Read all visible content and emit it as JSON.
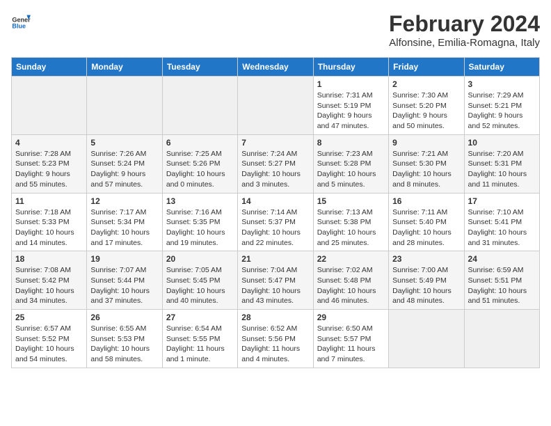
{
  "header": {
    "logo_general": "General",
    "logo_blue": "Blue",
    "title": "February 2024",
    "subtitle": "Alfonsine, Emilia-Romagna, Italy"
  },
  "days_of_week": [
    "Sunday",
    "Monday",
    "Tuesday",
    "Wednesday",
    "Thursday",
    "Friday",
    "Saturday"
  ],
  "weeks": [
    [
      {
        "day": "",
        "info": ""
      },
      {
        "day": "",
        "info": ""
      },
      {
        "day": "",
        "info": ""
      },
      {
        "day": "",
        "info": ""
      },
      {
        "day": "1",
        "info": "Sunrise: 7:31 AM\nSunset: 5:19 PM\nDaylight: 9 hours and 47 minutes."
      },
      {
        "day": "2",
        "info": "Sunrise: 7:30 AM\nSunset: 5:20 PM\nDaylight: 9 hours and 50 minutes."
      },
      {
        "day": "3",
        "info": "Sunrise: 7:29 AM\nSunset: 5:21 PM\nDaylight: 9 hours and 52 minutes."
      }
    ],
    [
      {
        "day": "4",
        "info": "Sunrise: 7:28 AM\nSunset: 5:23 PM\nDaylight: 9 hours and 55 minutes."
      },
      {
        "day": "5",
        "info": "Sunrise: 7:26 AM\nSunset: 5:24 PM\nDaylight: 9 hours and 57 minutes."
      },
      {
        "day": "6",
        "info": "Sunrise: 7:25 AM\nSunset: 5:26 PM\nDaylight: 10 hours and 0 minutes."
      },
      {
        "day": "7",
        "info": "Sunrise: 7:24 AM\nSunset: 5:27 PM\nDaylight: 10 hours and 3 minutes."
      },
      {
        "day": "8",
        "info": "Sunrise: 7:23 AM\nSunset: 5:28 PM\nDaylight: 10 hours and 5 minutes."
      },
      {
        "day": "9",
        "info": "Sunrise: 7:21 AM\nSunset: 5:30 PM\nDaylight: 10 hours and 8 minutes."
      },
      {
        "day": "10",
        "info": "Sunrise: 7:20 AM\nSunset: 5:31 PM\nDaylight: 10 hours and 11 minutes."
      }
    ],
    [
      {
        "day": "11",
        "info": "Sunrise: 7:18 AM\nSunset: 5:33 PM\nDaylight: 10 hours and 14 minutes."
      },
      {
        "day": "12",
        "info": "Sunrise: 7:17 AM\nSunset: 5:34 PM\nDaylight: 10 hours and 17 minutes."
      },
      {
        "day": "13",
        "info": "Sunrise: 7:16 AM\nSunset: 5:35 PM\nDaylight: 10 hours and 19 minutes."
      },
      {
        "day": "14",
        "info": "Sunrise: 7:14 AM\nSunset: 5:37 PM\nDaylight: 10 hours and 22 minutes."
      },
      {
        "day": "15",
        "info": "Sunrise: 7:13 AM\nSunset: 5:38 PM\nDaylight: 10 hours and 25 minutes."
      },
      {
        "day": "16",
        "info": "Sunrise: 7:11 AM\nSunset: 5:40 PM\nDaylight: 10 hours and 28 minutes."
      },
      {
        "day": "17",
        "info": "Sunrise: 7:10 AM\nSunset: 5:41 PM\nDaylight: 10 hours and 31 minutes."
      }
    ],
    [
      {
        "day": "18",
        "info": "Sunrise: 7:08 AM\nSunset: 5:42 PM\nDaylight: 10 hours and 34 minutes."
      },
      {
        "day": "19",
        "info": "Sunrise: 7:07 AM\nSunset: 5:44 PM\nDaylight: 10 hours and 37 minutes."
      },
      {
        "day": "20",
        "info": "Sunrise: 7:05 AM\nSunset: 5:45 PM\nDaylight: 10 hours and 40 minutes."
      },
      {
        "day": "21",
        "info": "Sunrise: 7:04 AM\nSunset: 5:47 PM\nDaylight: 10 hours and 43 minutes."
      },
      {
        "day": "22",
        "info": "Sunrise: 7:02 AM\nSunset: 5:48 PM\nDaylight: 10 hours and 46 minutes."
      },
      {
        "day": "23",
        "info": "Sunrise: 7:00 AM\nSunset: 5:49 PM\nDaylight: 10 hours and 48 minutes."
      },
      {
        "day": "24",
        "info": "Sunrise: 6:59 AM\nSunset: 5:51 PM\nDaylight: 10 hours and 51 minutes."
      }
    ],
    [
      {
        "day": "25",
        "info": "Sunrise: 6:57 AM\nSunset: 5:52 PM\nDaylight: 10 hours and 54 minutes."
      },
      {
        "day": "26",
        "info": "Sunrise: 6:55 AM\nSunset: 5:53 PM\nDaylight: 10 hours and 58 minutes."
      },
      {
        "day": "27",
        "info": "Sunrise: 6:54 AM\nSunset: 5:55 PM\nDaylight: 11 hours and 1 minute."
      },
      {
        "day": "28",
        "info": "Sunrise: 6:52 AM\nSunset: 5:56 PM\nDaylight: 11 hours and 4 minutes."
      },
      {
        "day": "29",
        "info": "Sunrise: 6:50 AM\nSunset: 5:57 PM\nDaylight: 11 hours and 7 minutes."
      },
      {
        "day": "",
        "info": ""
      },
      {
        "day": "",
        "info": ""
      }
    ]
  ]
}
